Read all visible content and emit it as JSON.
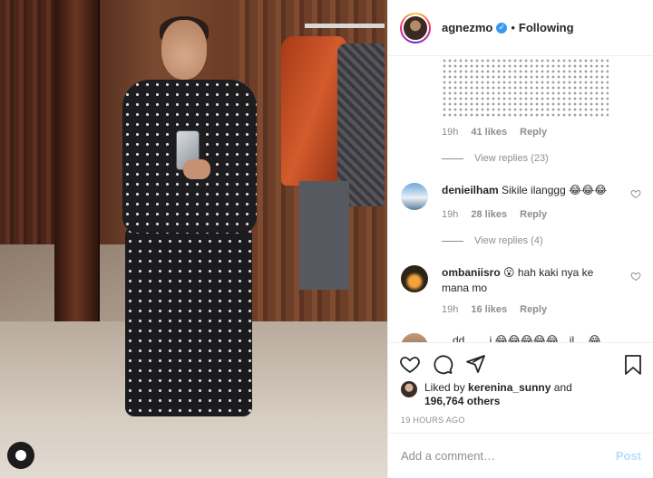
{
  "post": {
    "username": "agnezmo",
    "follow_separator": "•",
    "follow_status": "Following"
  },
  "comments": {
    "first": {
      "time": "19h",
      "likes": "41 likes",
      "reply": "Reply",
      "view_replies": "View replies (23)"
    },
    "c1": {
      "username": "denieilham",
      "text": "Sikile ilanggg 😂😂😂",
      "time": "19h",
      "likes": "28 likes",
      "reply": "Reply",
      "view_replies": "View replies (4)"
    },
    "c2": {
      "username": "ombaniisro",
      "text": "😮 hah kaki nya ke mana mo",
      "time": "19h",
      "likes": "16 likes",
      "reply": "Reply"
    },
    "c3": {
      "partial_text": "…dd…  …i  😂😂😂😂😂…il…  😂"
    }
  },
  "likes": {
    "prefix": "Liked by",
    "user": "kerenina_sunny",
    "and": "and",
    "others": "196,764 others"
  },
  "timestamp": "19 HOURS AGO",
  "composer": {
    "placeholder": "Add a comment…",
    "post_label": "Post"
  },
  "colors": {
    "verified": "#3897f0",
    "post_disabled": "#b2dffc",
    "secondary_text": "#8e8e8e"
  },
  "icons": [
    "heart-icon",
    "comment-icon",
    "share-icon",
    "bookmark-icon",
    "verified-icon",
    "profile-chip-icon"
  ]
}
